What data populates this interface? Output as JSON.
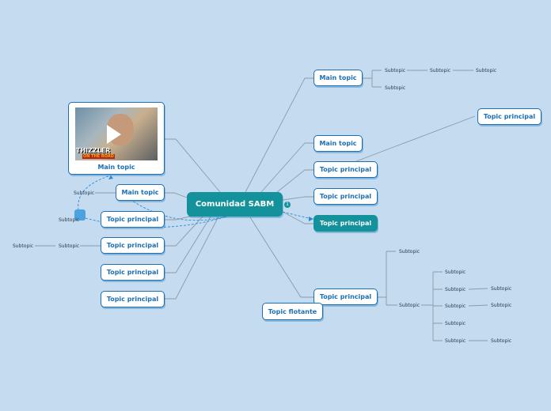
{
  "central": {
    "label": "Comunidad SABM"
  },
  "badge": "1",
  "left": {
    "image_topic": {
      "label": "Main topic",
      "video_caption": "THIZZLER",
      "video_subcaption": "ON THE ROAD"
    },
    "main_topic": {
      "label": "Main topic",
      "subtopic": "Subtopic"
    },
    "topic_marker": {
      "label": "Topic principal",
      "subtopic": "Subtopic"
    },
    "topic_chain": {
      "label": "Topic principal",
      "sub1": "Subtopic",
      "sub2": "Subtopic"
    },
    "topic_a": {
      "label": "Topic principal"
    },
    "topic_b": {
      "label": "Topic principal"
    }
  },
  "right": {
    "main_topic_1": {
      "label": "Main topic",
      "chain": [
        "Subtopic",
        "Subtopic",
        "Subtopic"
      ],
      "sub2": "Subtopic"
    },
    "main_topic_2": {
      "label": "Main topic",
      "child": "Topic principal"
    },
    "topic_1": {
      "label": "Topic principal"
    },
    "topic_2": {
      "label": "Topic principal"
    },
    "topic_selected": {
      "label": "Topic principal"
    },
    "topic_bottom": {
      "label": "Topic principal",
      "sub_top": "Subtopic",
      "sub_mid": "Subtopic",
      "children": [
        {
          "label": "Subtopic"
        },
        {
          "label": "Subtopic",
          "child": "Subtopic"
        },
        {
          "label": "Subtopic",
          "child": "Subtopic"
        },
        {
          "label": "Subtopic"
        },
        {
          "label": "Subtopic",
          "child": "Subtopic"
        }
      ]
    }
  },
  "floating": {
    "label": "Topic flotante"
  },
  "colors": {
    "background": "#c5dcf0",
    "accent": "#13929b",
    "node_border": "#1b6fb5"
  }
}
